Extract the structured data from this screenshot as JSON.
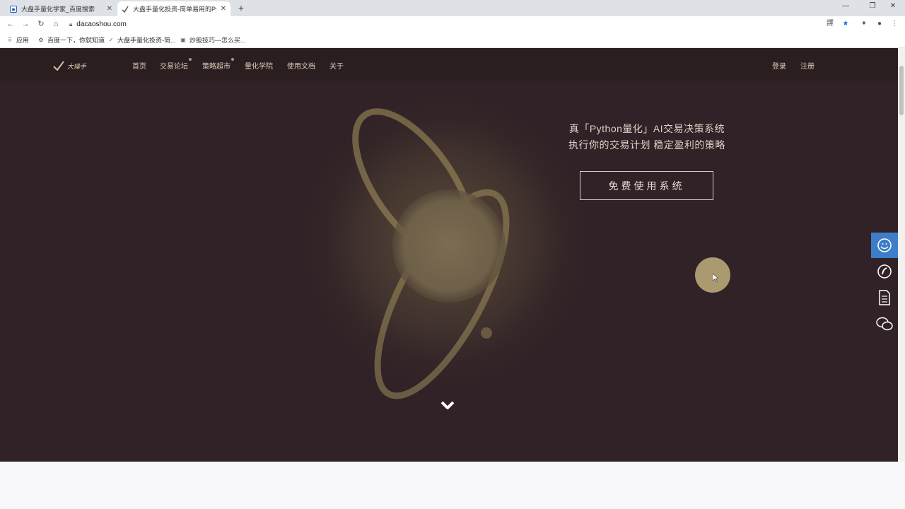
{
  "browser": {
    "tabs": [
      {
        "title": "大盘手量化学家_百度搜索",
        "active": false
      },
      {
        "title": "大盘手量化投资-简单易用的Py...",
        "active": true
      }
    ],
    "new_tab": "+",
    "window_controls": {
      "minimize": "—",
      "restore": "❐",
      "close": "✕"
    },
    "address": "dacaoshou.com",
    "bookmarks": [
      {
        "label": "应用"
      },
      {
        "label": "百度一下，你就知道"
      },
      {
        "label": "大盘手量化投资-简..."
      },
      {
        "label": "炒股技巧---怎么买..."
      }
    ]
  },
  "site": {
    "logo_text": "大操手",
    "nav": [
      {
        "label": "首页",
        "badge": false
      },
      {
        "label": "交易论坛",
        "badge": true
      },
      {
        "label": "策略超市",
        "badge": true
      },
      {
        "label": "量化学院",
        "badge": false
      },
      {
        "label": "使用文档",
        "badge": false
      },
      {
        "label": "关于",
        "badge": false
      }
    ],
    "login": "登录",
    "register": "注册",
    "hero": {
      "line1": "真「Python量化」AI交易决策系统",
      "line2": "执行你的交易计划 稳定盈利的策略",
      "cta": "免费使用系统"
    },
    "side_widget": [
      "qq-icon",
      "phone-icon",
      "document-icon",
      "wechat-icon"
    ]
  },
  "colors": {
    "page_bg": "#302226",
    "nav_bg": "#2b1e21",
    "nav_text": "#d8ccb4",
    "accent": "#b9a679",
    "side_active": "#3d7dca"
  }
}
